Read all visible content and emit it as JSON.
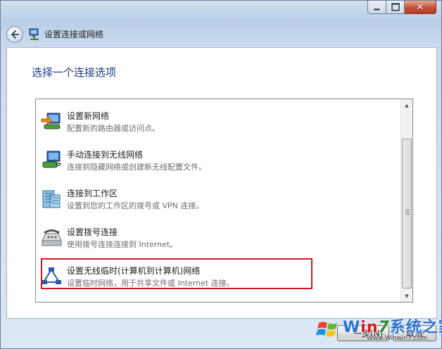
{
  "window": {
    "title": "设置连接或网络",
    "close_glyph": "✕"
  },
  "page": {
    "heading": "选择一个连接选项"
  },
  "options": [
    {
      "title": "设置新网络",
      "description": "配置新的路由器或访问点。",
      "icon": "router-setup-icon"
    },
    {
      "title": "手动连接到无线网络",
      "description": "连接到隐藏网络或创建新无线配置文件。",
      "icon": "wireless-manual-icon"
    },
    {
      "title": "连接到工作区",
      "description": "设置到您的工作区的拨号或 VPN 连接。",
      "icon": "workplace-building-icon"
    },
    {
      "title": "设置拨号连接",
      "description": "使用拨号连接连接到 Internet。",
      "icon": "dialup-phone-icon"
    },
    {
      "title": "设置无线临时(计算机到计算机)网络",
      "description": "设置临时网络，用于共享文件或 Internet 连接。",
      "icon": "adhoc-network-icon"
    }
  ],
  "footer": {
    "next_label": "一步(N)",
    "cancel_label": "取消"
  },
  "watermark": {
    "brand_w": "W",
    "brand_in": "in",
    "brand_7": "7",
    "brand_rest": "系统之家",
    "url": "Www.Winwin7.com"
  },
  "colors": {
    "heading": "#1f3a8a",
    "highlight_border": "#d4171e",
    "description_text": "#6d6d6d"
  }
}
